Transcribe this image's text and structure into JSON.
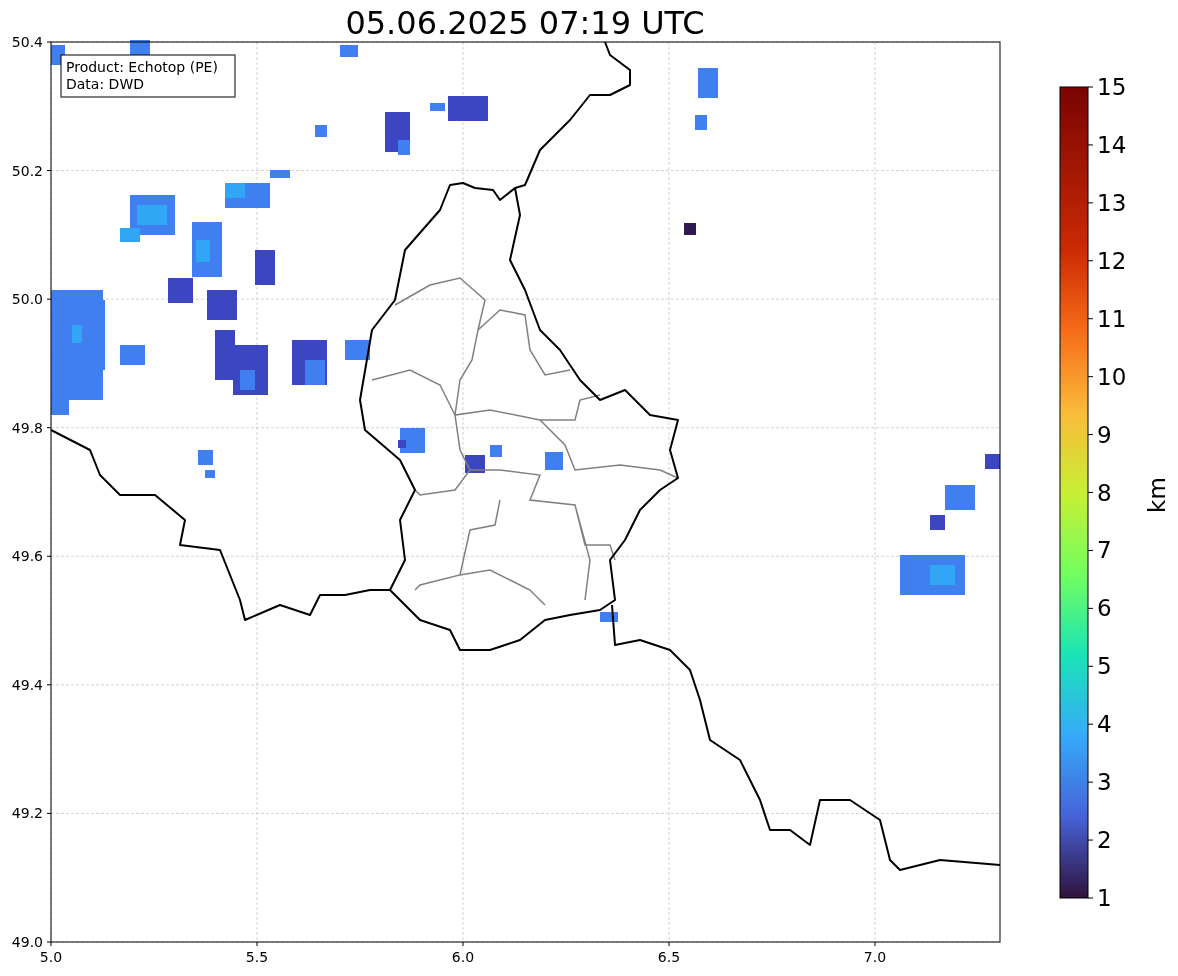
{
  "title": "05.06.2025 07:19 UTC",
  "annotation": [
    "Product: Echotop (PE)",
    "Data: DWD"
  ],
  "map": {
    "x_tick_labels": [
      "5.0",
      "5.5",
      "6.0",
      "6.5",
      "7.0"
    ],
    "y_tick_labels": [
      "50.4",
      "50.2",
      "50.0",
      "49.8",
      "49.6",
      "49.4",
      "49.2",
      "49.0"
    ]
  },
  "colorbar": {
    "label": "km",
    "tick_labels": [
      "15",
      "14",
      "13",
      "12",
      "11",
      "10",
      "9",
      "8",
      "7",
      "6",
      "5",
      "4",
      "3",
      "2",
      "1"
    ]
  }
}
